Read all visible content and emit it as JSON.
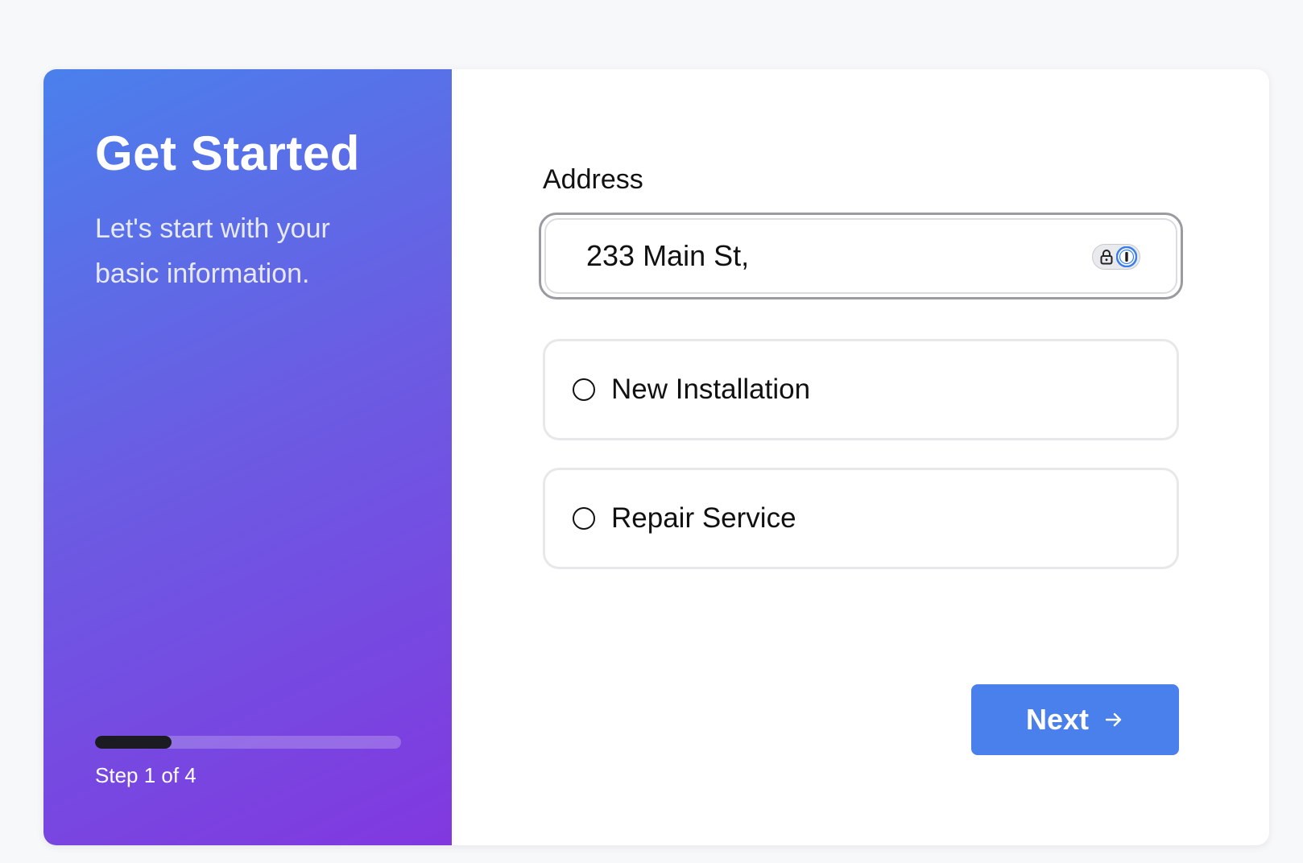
{
  "sidebar": {
    "title": "Get Started",
    "subtitle": "Let's start with your basic information.",
    "progress": {
      "current": 1,
      "total": 4,
      "fraction": 0.25
    },
    "step_text": "Step 1 of 4"
  },
  "form": {
    "address_label": "Address",
    "address_value": "233 Main St,",
    "password_manager_icons": [
      "lock-icon",
      "password-manager-icon"
    ],
    "options": [
      {
        "label": "New Installation",
        "selected": false
      },
      {
        "label": "Repair Service",
        "selected": false
      }
    ],
    "next_label": "Next",
    "next_icon": "arrow-right-icon"
  },
  "colors": {
    "accent": "#4a80ec",
    "gradient_start": "#4a80ec",
    "gradient_end": "#8138df",
    "progress_fill": "#1b1b22"
  }
}
